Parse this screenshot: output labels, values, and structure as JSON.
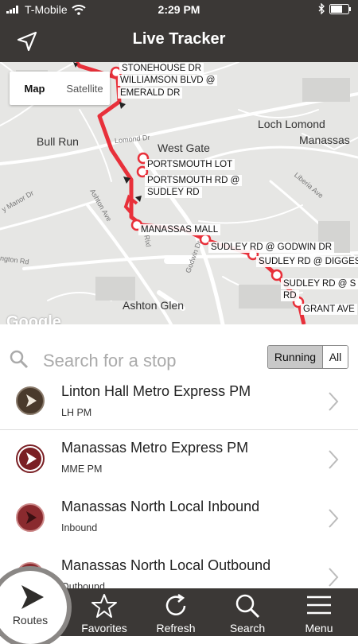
{
  "status_bar": {
    "carrier": "T-Mobile",
    "time": "2:29 PM"
  },
  "header": {
    "title": "Live Tracker"
  },
  "map": {
    "toggle": {
      "map": "Map",
      "satellite": "Satellite"
    },
    "places": [
      "Loch Lomond",
      "Manassas",
      "Bull Run",
      "West Gate",
      "Ashton Glen"
    ],
    "streets": [
      "Lomond Dr",
      "Liberia Ave",
      "Ashton Ave",
      "Godwin Dr",
      "ngton Rd",
      "y Manor Dr",
      "Rixl"
    ],
    "stops": [
      "STONEHOUSE DR",
      "WILLIAMSON BLVD @",
      "EMERALD DR",
      "PORTSMOUTH LOT",
      "PORTSMOUTH RD @",
      "SUDLEY RD",
      "MANASSAS MALL",
      "SUDLEY RD @ GODWIN DR",
      "SUDLEY RD @ DIGGES",
      "SUDLEY RD @ S",
      "RD",
      "GRANT AVE"
    ],
    "attribution": "Google",
    "route_color": "#e8303a"
  },
  "search": {
    "placeholder": "Search for a stop",
    "running_label": "Running",
    "all_label": "All"
  },
  "routes": [
    {
      "name": "Linton Hall Metro Express PM",
      "code": "LH PM",
      "icon_color": "#4a3a2c"
    },
    {
      "name": "Manassas Metro Express PM",
      "code": "MME PM",
      "icon_color": "#7a1f24"
    },
    {
      "name": "Manassas North Local Inbound",
      "code": "Inbound",
      "icon_color": "#8a2a2e"
    },
    {
      "name": "Manassas North Local Outbound",
      "code": "Outbound",
      "icon_color": "#8a2a2e"
    }
  ],
  "tabs": [
    {
      "label": "Routes",
      "icon": "play-arrow-icon"
    },
    {
      "label": "Favorites",
      "icon": "star-icon"
    },
    {
      "label": "Refresh",
      "icon": "refresh-icon"
    },
    {
      "label": "Search",
      "icon": "search-icon"
    },
    {
      "label": "Menu",
      "icon": "menu-icon"
    }
  ],
  "colors": {
    "bar": "#3b3836",
    "accent": "#e8303a"
  }
}
